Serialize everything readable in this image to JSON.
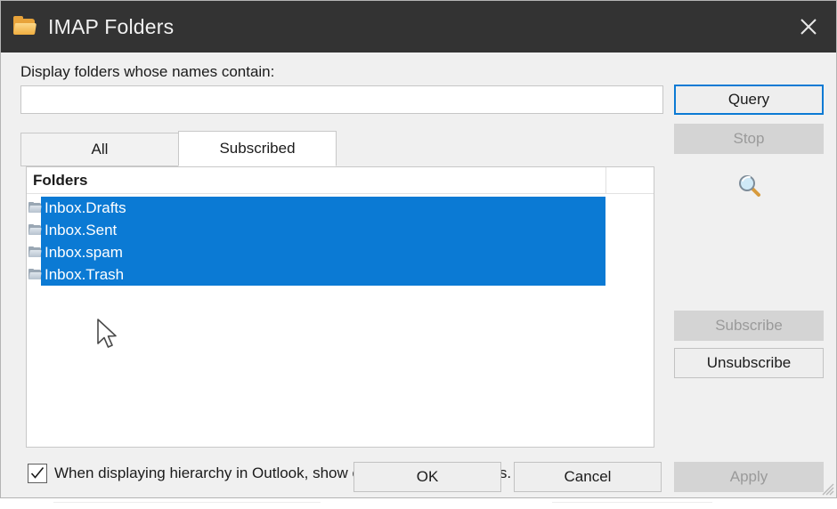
{
  "window": {
    "title": "IMAP Folders",
    "icon": "folder-icon",
    "close_icon": "close-icon"
  },
  "filter": {
    "label": "Display folders whose names contain:",
    "value": "",
    "placeholder": ""
  },
  "tabs": [
    {
      "label": "All",
      "active": false
    },
    {
      "label": "Subscribed",
      "active": true
    }
  ],
  "list": {
    "column_header": "Folders",
    "rows": [
      {
        "label": "Inbox.Drafts",
        "selected": true,
        "icon": "folder-icon"
      },
      {
        "label": "Inbox.Sent",
        "selected": true,
        "icon": "folder-icon"
      },
      {
        "label": "Inbox.spam",
        "selected": true,
        "icon": "folder-icon"
      },
      {
        "label": "Inbox.Trash",
        "selected": true,
        "icon": "folder-icon"
      }
    ]
  },
  "side_buttons": {
    "query": "Query",
    "stop": "Stop",
    "search_icon": "magnifier-icon",
    "subscribe": "Subscribe",
    "unsubscribe": "Unsubscribe"
  },
  "checkbox": {
    "label": "When displaying hierarchy in Outlook, show only subscribed folders.",
    "checked": true
  },
  "footer_buttons": {
    "ok": "OK",
    "cancel": "Cancel",
    "apply": "Apply"
  },
  "colors": {
    "titlebar": "#333333",
    "dialog_bg": "#f0f0f0",
    "selection": "#0b7ad4",
    "focus_border": "#0b7ad4",
    "disabled_bg": "#d4d4d4",
    "disabled_text": "#9a9a9a",
    "text": "#1b1b1b"
  }
}
